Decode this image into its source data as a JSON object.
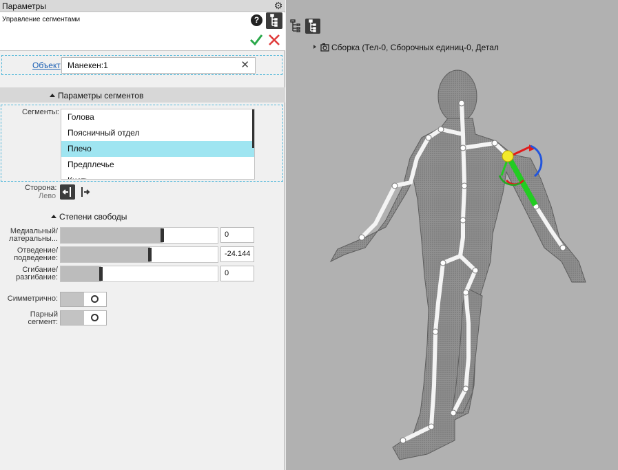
{
  "panel": {
    "title": "Параметры",
    "subtitle": "Управление сегментами"
  },
  "object": {
    "link_label": "Объект",
    "value": "Манекен:1"
  },
  "segments_section": {
    "header": "Параметры сегментов",
    "label": "Сегменты:",
    "items": [
      "Голова",
      "Поясничный отдел",
      "Плечо",
      "Предплечье",
      "Кисть"
    ],
    "selected": "Плечо"
  },
  "side": {
    "label": "Сторона:",
    "value": "Лево"
  },
  "dof": {
    "header": "Степени свободы",
    "rows": [
      {
        "label1": "Медиальный/",
        "label2": "латеральны...",
        "value": "0",
        "level": 0.65
      },
      {
        "label1": "Отведение/",
        "label2": "подведение:",
        "value": "-24.144",
        "level": 0.57
      },
      {
        "label1": "Сгибание/",
        "label2": "разгибание:",
        "value": "0",
        "level": 0.26
      }
    ]
  },
  "toggles": {
    "symmetric_label": "Симметрично:",
    "paired_label1": "Парный",
    "paired_label2": "сегмент:"
  },
  "tree": {
    "root_label": "Сборка (Тел-0, Сборочных единиц-0, Детал"
  },
  "icons": [
    "gear-icon",
    "help-icon",
    "tree-view-icon",
    "check-icon",
    "close-icon",
    "clear-icon",
    "side-left-icon",
    "side-right-icon",
    "expand-arrow-icon",
    "assembly-icon"
  ],
  "colors": {
    "selection": "#9fe5f1",
    "ok": "#2aa84a",
    "cancel": "#e03a3a",
    "link": "#1a5fb4",
    "axis_x": "#e11b1b",
    "axis_y": "#22cc22",
    "axis_z": "#2255dd",
    "gizmo_ball": "#f4ea2a"
  }
}
